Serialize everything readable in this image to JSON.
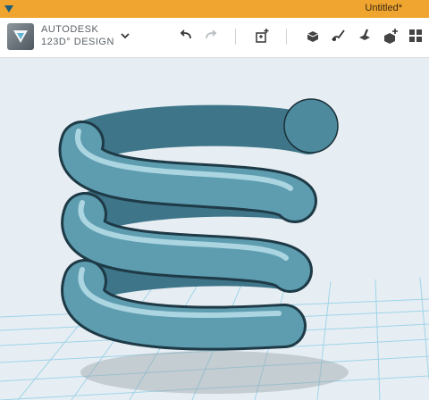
{
  "window": {
    "title": "Untitled*"
  },
  "brand": {
    "line1": "AUTODESK",
    "line2": "123D° DESIGN"
  },
  "toolbar": {
    "icons": [
      "undo-icon",
      "redo-icon",
      "add-primitive-icon",
      "shape-tools-icon",
      "sketch-icon",
      "modify-icon",
      "combine-icon",
      "pattern-icon"
    ]
  },
  "colors": {
    "titlebar": "#f0a530",
    "viewport_bg": "#e7eef3",
    "spring": "#5e9db0",
    "grid": "#9fd4e8"
  }
}
